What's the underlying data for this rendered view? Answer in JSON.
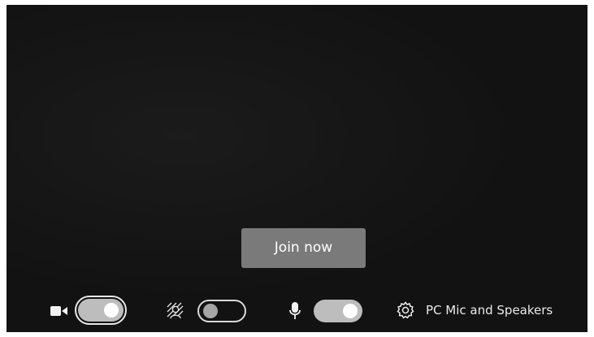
{
  "join_button": {
    "label": "Join now"
  },
  "controls": {
    "camera": {
      "icon": "camera-icon",
      "enabled": true
    },
    "background_effects": {
      "icon": "background-effects-icon",
      "enabled": false
    },
    "microphone": {
      "icon": "microphone-icon",
      "enabled": true
    },
    "audio_device": {
      "icon": "gear-icon",
      "label": "PC Mic and Speakers"
    }
  },
  "colors": {
    "video_background": "#141414",
    "join_button": "#7a7a7a",
    "toggle_on": "#bdbdbd",
    "text": "#eaeaea"
  }
}
